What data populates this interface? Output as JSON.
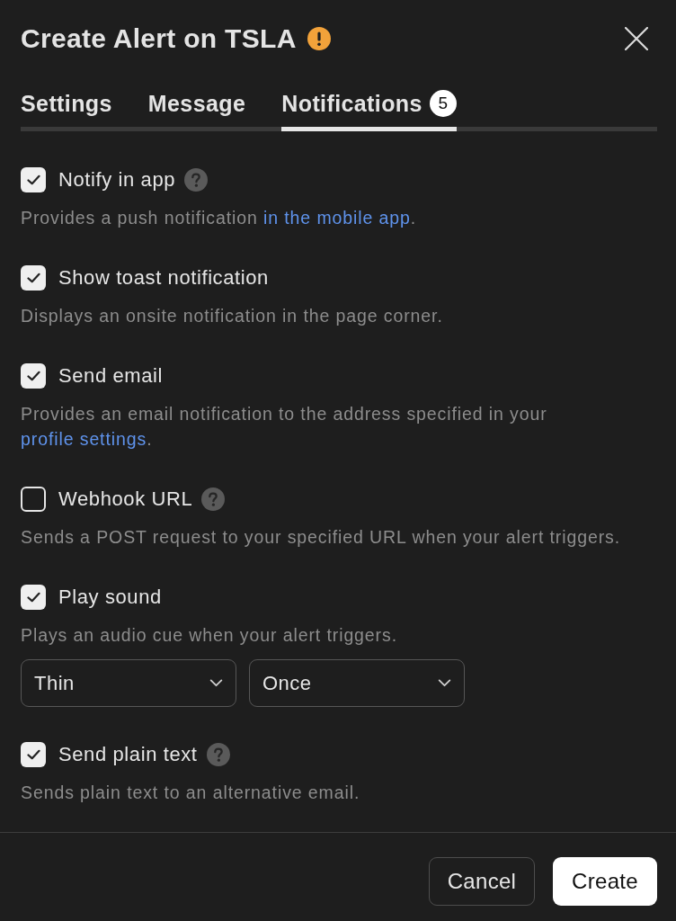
{
  "title": "Create Alert on TSLA",
  "tabs": [
    {
      "label": "Settings",
      "selected": false
    },
    {
      "label": "Message",
      "selected": false
    },
    {
      "label": "Notifications",
      "selected": true,
      "badge": "5"
    }
  ],
  "options": [
    {
      "label": "Notify in app",
      "checked": true,
      "help": true,
      "description": [
        {
          "kind": "text",
          "text": "Provides a push notification "
        },
        {
          "kind": "link",
          "text": "in the mobile app"
        },
        {
          "kind": "text",
          "text": "."
        }
      ]
    },
    {
      "label": "Show toast notification",
      "checked": true,
      "help": false,
      "description": [
        {
          "kind": "text",
          "text": "Displays an onsite notification in the page corner."
        }
      ]
    },
    {
      "label": "Send email",
      "checked": true,
      "help": false,
      "description": [
        {
          "kind": "text",
          "text": "Provides an email notification to the address specified in your "
        },
        {
          "kind": "link",
          "text": "profile settings"
        },
        {
          "kind": "text",
          "text": "."
        }
      ]
    },
    {
      "label": "Webhook URL",
      "checked": false,
      "help": true,
      "description": [
        {
          "kind": "text",
          "text": "Sends a POST request to your specified URL when your alert triggers."
        }
      ]
    },
    {
      "label": "Play sound",
      "checked": true,
      "help": false,
      "description": [
        {
          "kind": "text",
          "text": "Plays an audio cue when your alert triggers."
        }
      ],
      "dropdowns": [
        {
          "value": "Thin"
        },
        {
          "value": "Once"
        }
      ]
    },
    {
      "label": "Send plain text",
      "checked": true,
      "help": true,
      "description": [
        {
          "kind": "text",
          "text": "Sends plain text to an alternative email."
        }
      ]
    }
  ],
  "buttons": [
    {
      "label": "Cancel",
      "kind": "secondary"
    },
    {
      "label": "Create",
      "kind": "primary"
    }
  ]
}
